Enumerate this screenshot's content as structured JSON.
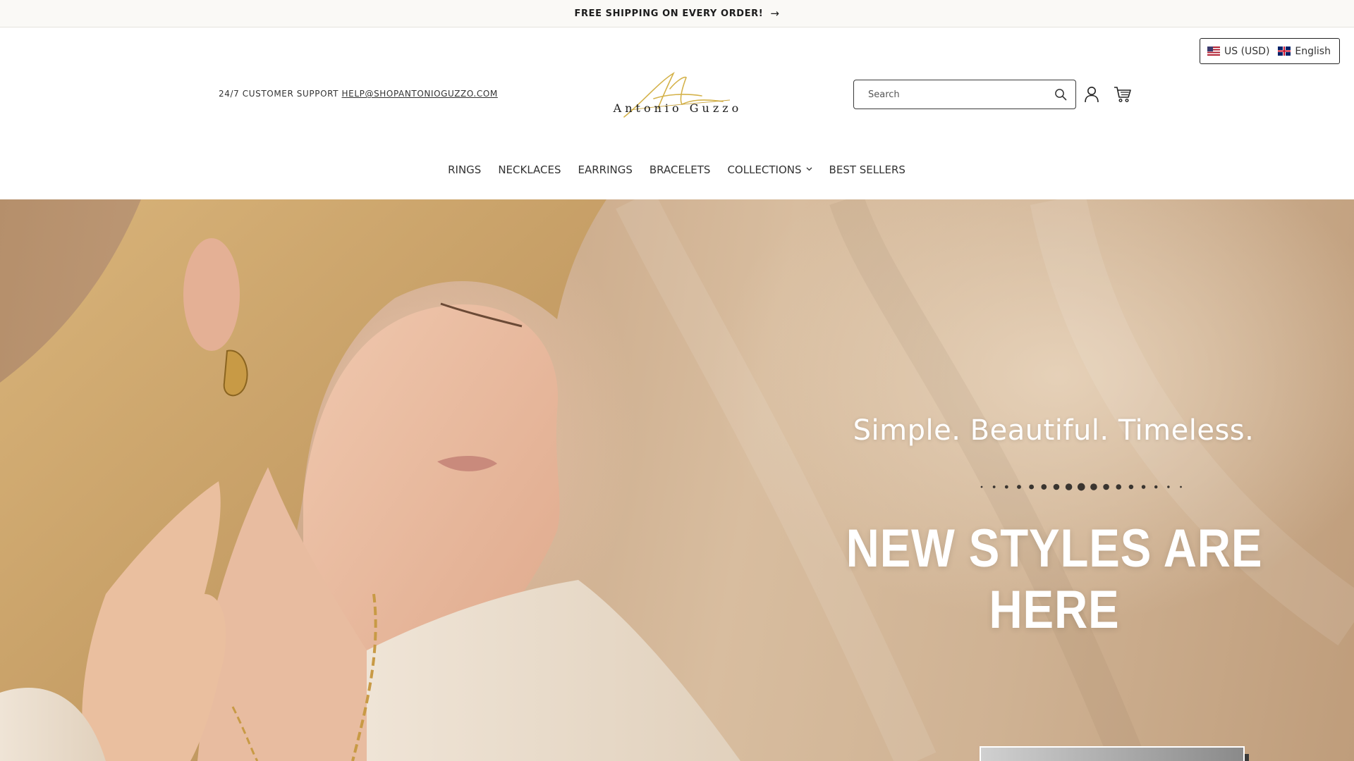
{
  "announcement": {
    "text": "FREE SHIPPING ON EVERY ORDER!",
    "arrow_icon": "arrow-right-icon"
  },
  "localization": {
    "currency": "US (USD)",
    "language": "English"
  },
  "support": {
    "label": "24/7 CUSTOMER SUPPORT",
    "email": "HELP@SHOPANTONIOGUZZO.COM"
  },
  "logo": {
    "text": "Antonio Guzzo"
  },
  "search": {
    "placeholder": "Search",
    "icon": "search-icon"
  },
  "header_icons": [
    "account-icon",
    "cart-icon"
  ],
  "nav": {
    "items": [
      {
        "label": "RINGS"
      },
      {
        "label": "NECKLACES"
      },
      {
        "label": "EARRINGS"
      },
      {
        "label": "BRACELETS"
      },
      {
        "label": "COLLECTIONS",
        "has_dropdown": true
      },
      {
        "label": "BEST SELLERS"
      }
    ]
  },
  "hero": {
    "tagline": "Simple. Beautiful. Timeless.",
    "headline": "NEW STYLES ARE HERE"
  },
  "colors": {
    "announcement_bg": "#faf9f6",
    "logo_gold": "#d4b24a",
    "text_dark": "#222222",
    "hero_text": "#ffffff"
  }
}
